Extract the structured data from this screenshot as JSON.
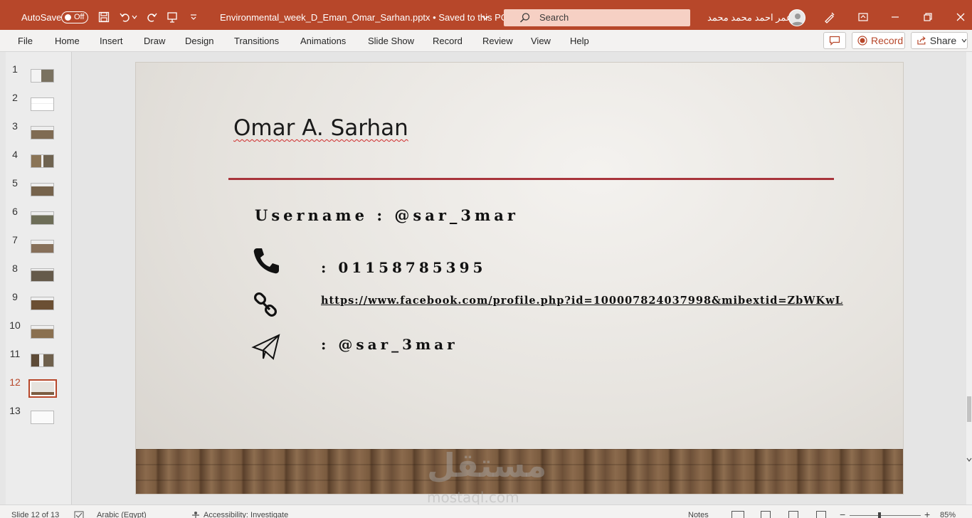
{
  "app": {
    "autosave_label": "AutoSave",
    "autosave_state": "Off",
    "document_title": "Environmental_week_D_Eman_Omar_Sarhan.pptx  •  Saved to this PC",
    "search_placeholder": "Search",
    "user_name": "عمر احمد محمد محمد",
    "accent_color": "#b7472a"
  },
  "menu": {
    "tabs": [
      "File",
      "Home",
      "Insert",
      "Draw",
      "Design",
      "Transitions",
      "Animations",
      "Slide Show",
      "Record",
      "Review",
      "View",
      "Help"
    ],
    "record_label": "Record",
    "share_label": "Share"
  },
  "thumbnails": {
    "numbers": [
      "1",
      "2",
      "3",
      "4",
      "5",
      "6",
      "7",
      "8",
      "9",
      "10",
      "11",
      "12",
      "13"
    ],
    "active_index": 12
  },
  "slide": {
    "title": "Omar A. Sarhan",
    "username_line": "Username  : @sar_3mar",
    "phone_line": ": 01158785395",
    "facebook_link": "https://www.facebook.com/profile.php?id=100007824037998&mibextid=ZbWKwL",
    "telegram_line": ": @sar_3mar"
  },
  "status": {
    "slide_counter": "Slide 12 of 13",
    "language": "Arabic (Egypt)",
    "accessibility": "Accessibility: Investigate",
    "notes": "Notes",
    "zoom": "85%"
  },
  "watermark": {
    "arabic": "مستقل",
    "latin": "mostaql.com"
  }
}
